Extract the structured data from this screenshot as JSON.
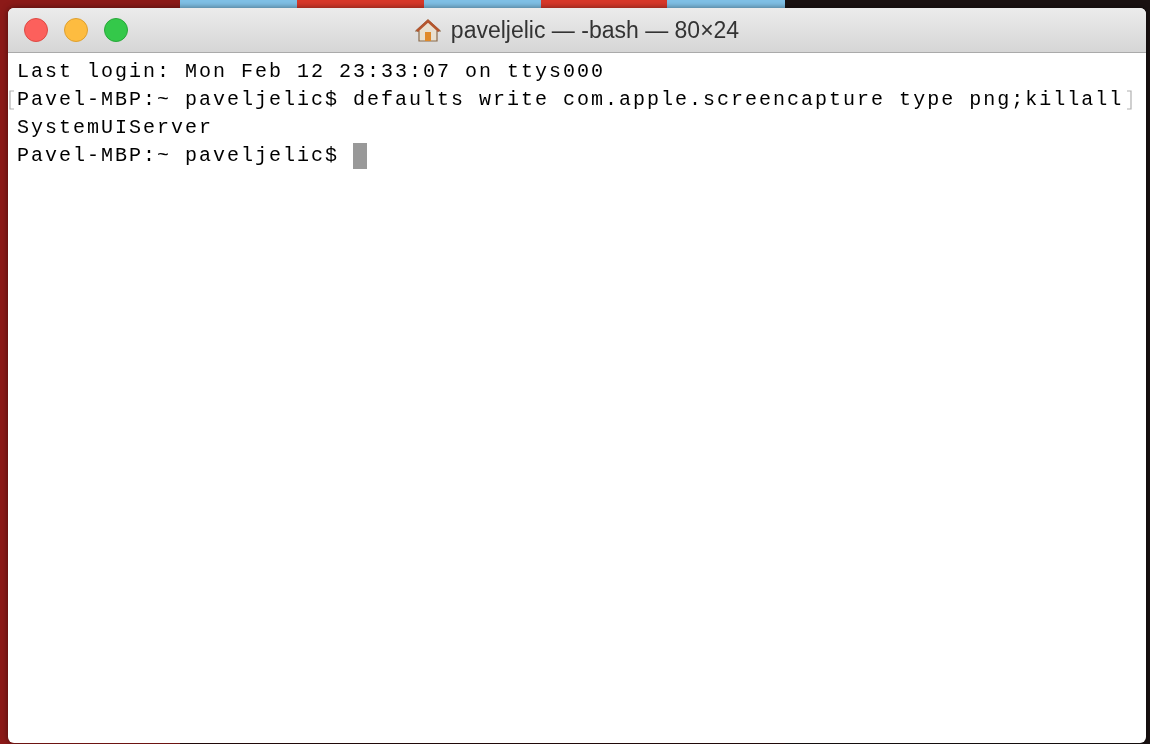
{
  "window": {
    "title": "paveljelic — -bash — 80×24"
  },
  "terminal": {
    "lines": [
      {
        "text": "Last login: Mon Feb 12 23:33:07 on ttys000",
        "wrapped": false,
        "cursor": false
      },
      {
        "text": "Pavel-MBP:~ paveljelic$ defaults write com.apple.screencapture type png;killall",
        "wrapped": true,
        "cursor": false
      },
      {
        "text": "SystemUIServer",
        "wrapped": false,
        "cursor": false
      },
      {
        "text": "Pavel-MBP:~ paveljelic$ ",
        "wrapped": false,
        "cursor": true
      }
    ]
  }
}
